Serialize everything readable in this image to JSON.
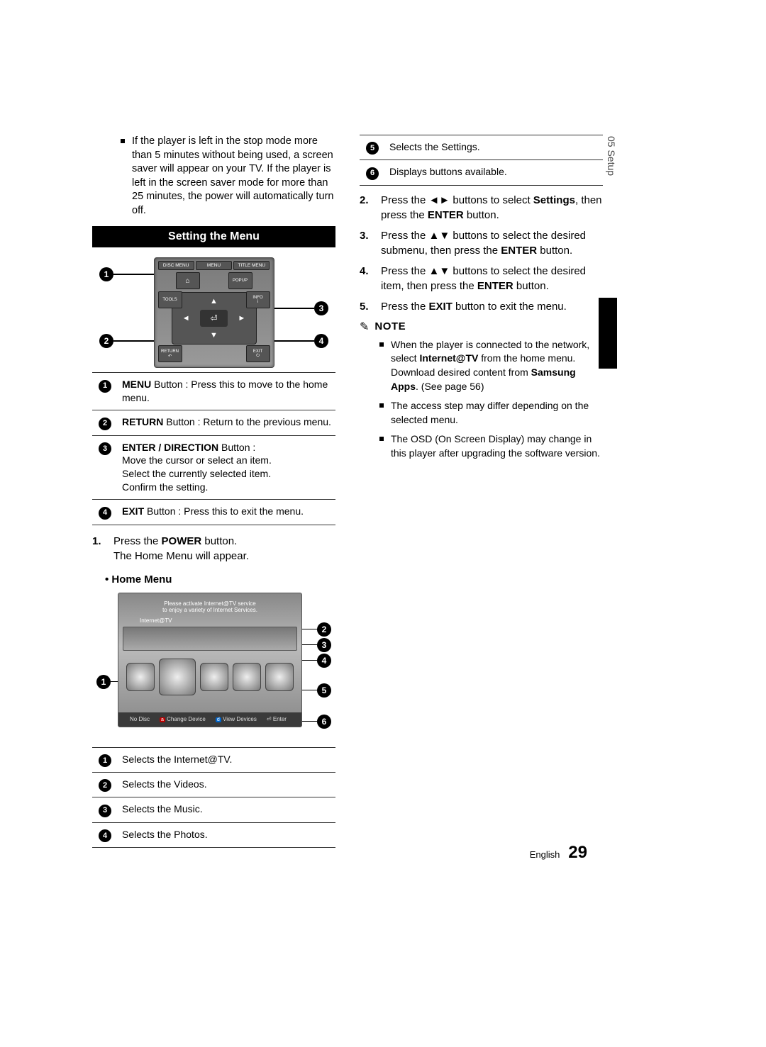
{
  "side_tab": "05   Setup",
  "top_para": "If the player is left in the stop mode more than 5 minutes without being used, a screen saver will appear on your TV. If the player is left in the screen saver mode for more than 25 minutes, the power will automatically turn off.",
  "section_title": "Setting the Menu",
  "remote_labels": {
    "top": [
      "DISC MENU",
      "MENU",
      "TITLE MENU"
    ],
    "popup": "POPUP",
    "tools": "TOOLS",
    "info": "INFO",
    "return": "RETURN",
    "exit": "EXIT"
  },
  "remote_table": [
    {
      "n": "1",
      "bold": "MENU",
      "rest": " Button : Press this to move to the home menu."
    },
    {
      "n": "2",
      "bold": "RETURN",
      "rest": " Button : Return to the previous menu."
    },
    {
      "n": "3",
      "bold": "ENTER / DIRECTION",
      "rest": " Button :\nMove the cursor or select an item.\nSelect the currently selected item.\nConfirm the setting."
    },
    {
      "n": "4",
      "bold": "EXIT",
      "rest": " Button : Press this to exit the menu."
    }
  ],
  "step1_num": "1.",
  "step1_a": "Press the ",
  "step1_bold": "POWER",
  "step1_b": " button.",
  "step1_line2": "The Home Menu will appear.",
  "home_heading": "• Home Menu",
  "home_screen": {
    "msg1": "Please activate Internet@TV service",
    "msg2": "to enjoy a variety of Internet Services.",
    "itv_label": "Internet@TV",
    "bottom_nodisc": "No Disc",
    "bottom_change": "Change Device",
    "bottom_view": "View Devices",
    "bottom_enter": "Enter"
  },
  "home_table_left": [
    {
      "n": "1",
      "text": "Selects the Internet@TV."
    },
    {
      "n": "2",
      "text": "Selects the Videos."
    },
    {
      "n": "3",
      "text": "Selects the Music."
    },
    {
      "n": "4",
      "text": "Selects the Photos."
    }
  ],
  "home_table_right": [
    {
      "n": "5",
      "text": "Selects the Settings."
    },
    {
      "n": "6",
      "text": "Displays buttons available."
    }
  ],
  "steps_right": [
    {
      "n": "2.",
      "pre": "Press the ",
      "sym": "◄►",
      "mid": " buttons to select ",
      "bold": "Settings",
      "post": ", then press the ",
      "bold2": "ENTER",
      "post2": " button."
    },
    {
      "n": "3.",
      "pre": "Press the ",
      "sym": "▲▼",
      "mid": " buttons to select the desired submenu, then press the ",
      "bold": "ENTER",
      "post": " button."
    },
    {
      "n": "4.",
      "pre": "Press the ",
      "sym": "▲▼",
      "mid": " buttons to select the desired item, then press the ",
      "bold": "ENTER",
      "post": " button."
    },
    {
      "n": "5.",
      "pre": "Press the ",
      "bold": "EXIT",
      "post": " button to exit the menu."
    }
  ],
  "note_label": "NOTE",
  "notes": [
    {
      "pre": "When the player is connected to the network, select ",
      "b1": "Internet@TV",
      "mid": " from the home menu. Download desired content from ",
      "b2": "Samsung Apps",
      "post": ". (See page 56)"
    },
    {
      "plain": "The access step may differ depending on the selected menu."
    },
    {
      "plain": "The OSD (On Screen Display) may change in this player after upgrading the software version."
    }
  ],
  "footer_lang": "English",
  "footer_page": "29"
}
